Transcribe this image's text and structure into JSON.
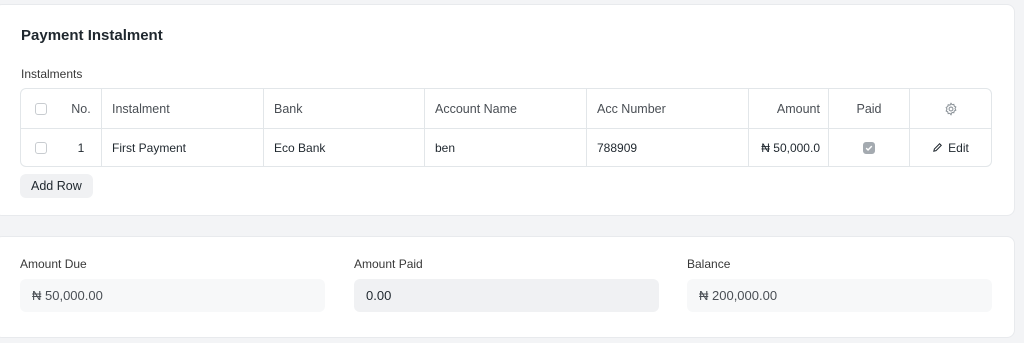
{
  "section": {
    "title": "Payment Instalment",
    "grid_label": "Instalments"
  },
  "table": {
    "headers": {
      "no": "No.",
      "instalment": "Instalment",
      "bank": "Bank",
      "account_name": "Account Name",
      "acc_number": "Acc Number",
      "amount": "Amount",
      "paid": "Paid"
    },
    "rows": [
      {
        "no": "1",
        "instalment": "First Payment",
        "bank": "Eco Bank",
        "account_name": "ben",
        "acc_number": "788909",
        "amount": "₦ 50,000.0",
        "paid": true,
        "edit_label": "Edit"
      }
    ],
    "settings_icon": "gear-icon"
  },
  "add_row_label": "Add Row",
  "totals": {
    "amount_due": {
      "label": "Amount Due",
      "value": "₦ 50,000.00"
    },
    "amount_paid": {
      "label": "Amount Paid",
      "value": "0.00"
    },
    "balance": {
      "label": "Balance",
      "value": "₦ 200,000.00"
    }
  },
  "colors": {
    "page_bg": "#f3f4f6",
    "card_bg": "#ffffff",
    "border": "#e2e6e9",
    "text": "#1f272e",
    "muted_text": "#4a4f55",
    "checked_box": "#a4aab0"
  }
}
